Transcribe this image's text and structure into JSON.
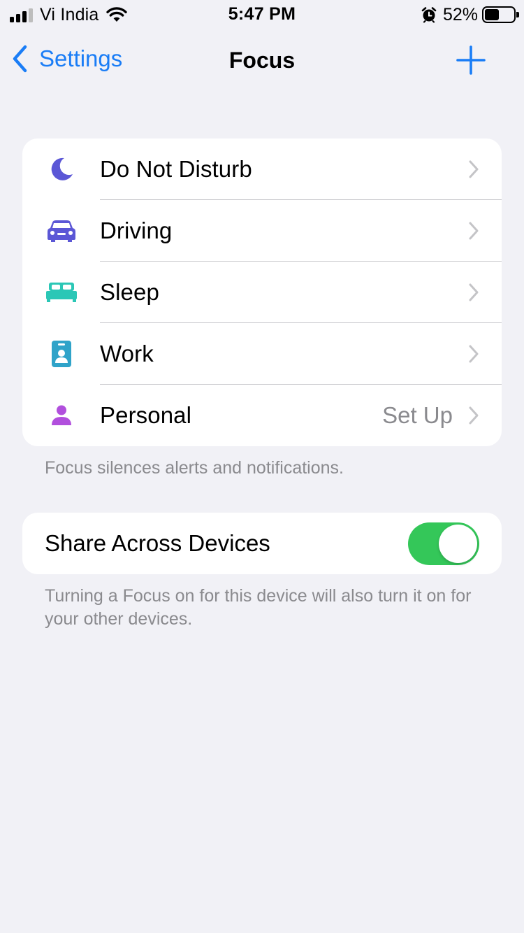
{
  "status_bar": {
    "carrier": "Vi India",
    "time": "5:47 PM",
    "battery_percent": "52%",
    "battery_level": 0.52,
    "signal_bars_active": 3,
    "icons": [
      "signal-icon",
      "wifi-icon",
      "alarm-icon",
      "battery-icon"
    ]
  },
  "nav": {
    "back_label": "Settings",
    "title": "Focus",
    "add_icon": "plus-icon",
    "accent_color": "#1a7df6"
  },
  "focus_modes": [
    {
      "label": "Do Not Disturb",
      "value": "",
      "icon": "moon-icon",
      "color": "#5b57d6"
    },
    {
      "label": "Driving",
      "value": "",
      "icon": "car-icon",
      "color": "#5b57d6"
    },
    {
      "label": "Sleep",
      "value": "",
      "icon": "bed-icon",
      "color": "#2bc7b6"
    },
    {
      "label": "Work",
      "value": "",
      "icon": "id-badge-icon",
      "color": "#2fa3c9"
    },
    {
      "label": "Personal",
      "value": "Set Up",
      "icon": "person-icon",
      "color": "#b14fdd"
    }
  ],
  "focus_footnote": "Focus silences alerts and notifications.",
  "share": {
    "label": "Share Across Devices",
    "enabled": true,
    "toggle_color": "#34c759",
    "footnote": "Turning a Focus on for this device will also turn it on for your other devices."
  }
}
